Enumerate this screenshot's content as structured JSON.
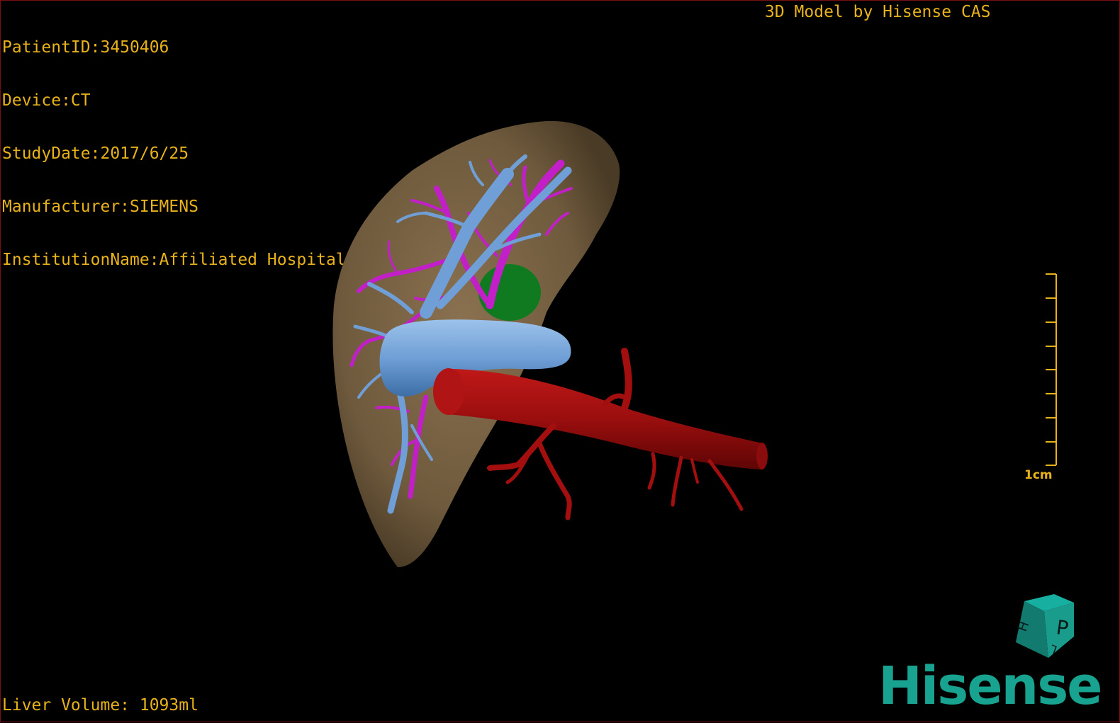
{
  "info": {
    "patient_id": "PatientID:3450406",
    "device": "Device:CT",
    "study_date": "StudyDate:2017/6/25",
    "manufacturer": "Manufacturer:SIEMENS",
    "institution": "InstitutionName:Affiliated Hospital Qingdao University-C"
  },
  "model_credit": "3D Model by Hisense CAS",
  "liver_volume": "Liver Volume: 1093ml",
  "scale_bar": {
    "label": "1cm"
  },
  "orientation_cube": {
    "face_front": "P",
    "face_side": "H",
    "face_top": "L"
  },
  "brand": "Hisense",
  "colors": {
    "overlay_text": "#e8b21a",
    "liver": "#7d6646",
    "portal_vein": "#6f9fd6",
    "hepatic_vein": "#c21fc9",
    "aorta": "#9e0f0f",
    "gallbladder": "#0f7a1f",
    "brand": "#17a38f"
  }
}
